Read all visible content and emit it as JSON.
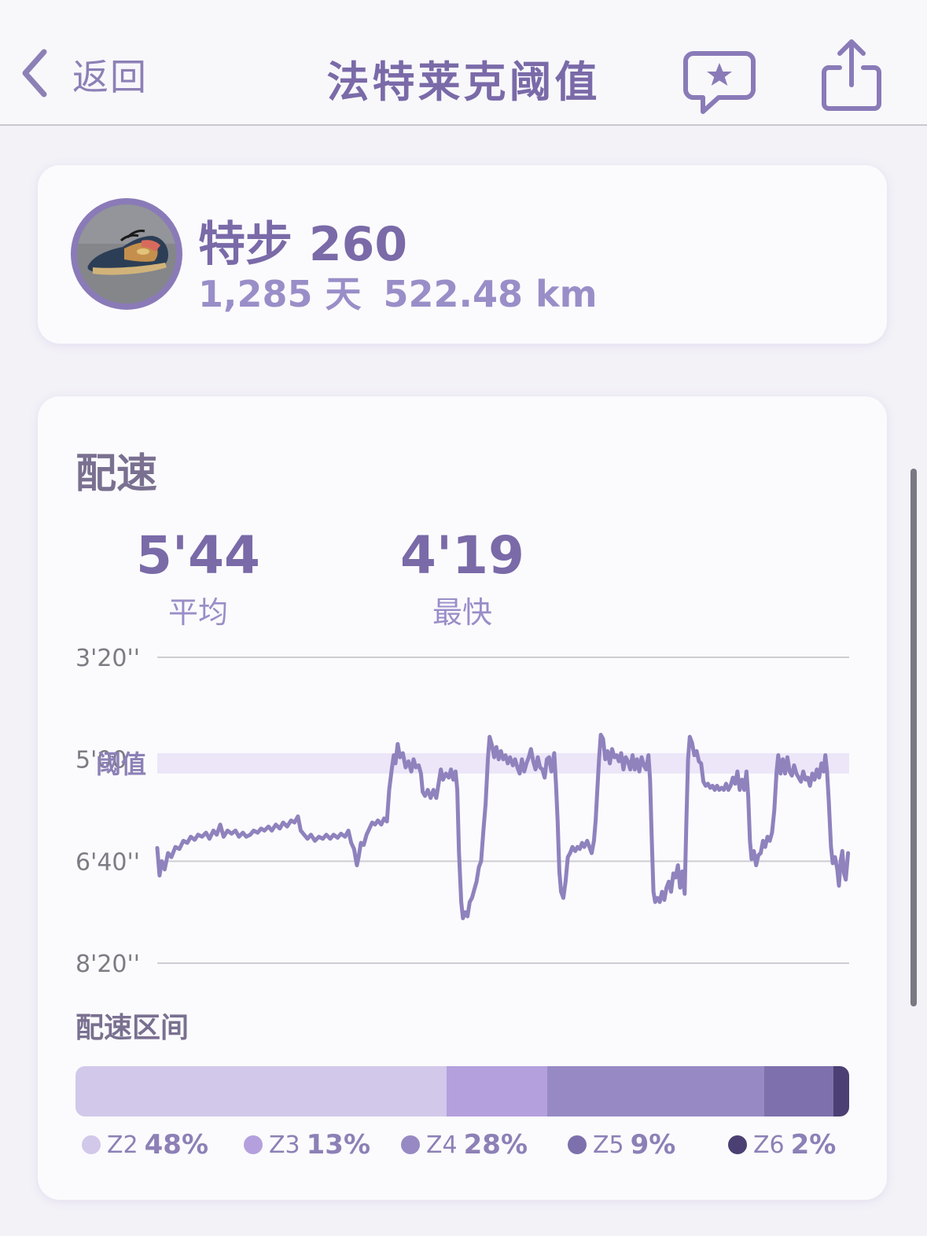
{
  "nav": {
    "back_label": "返回",
    "title": "法特莱克阈值"
  },
  "shoe": {
    "name": "特步 260",
    "days": "1,285 天",
    "distance": "522.48 km"
  },
  "pace": {
    "section_title": "配速",
    "average_value": "5'44",
    "average_label": "平均",
    "fastest_value": "4'19",
    "fastest_label": "最快"
  },
  "chart_data": {
    "type": "line",
    "y_ticks": [
      "3'20''",
      "5'00",
      "6'40''",
      "8'20''"
    ],
    "y_tick_seconds": [
      200,
      300,
      400,
      500
    ],
    "ylim": [
      200,
      500
    ],
    "y_reversed": true,
    "threshold_label": "阈值",
    "threshold_range_seconds": [
      294,
      314
    ],
    "x_range": [
      0,
      100
    ],
    "series": [
      {
        "points": [
          [
            0,
            387
          ],
          [
            0.4,
            414
          ],
          [
            0.8,
            400
          ],
          [
            1.3,
            408
          ],
          [
            1.9,
            392
          ],
          [
            2.5,
            396
          ],
          [
            3.2,
            386
          ],
          [
            3.9,
            388
          ],
          [
            4.6,
            380
          ],
          [
            5.3,
            382
          ],
          [
            5.9,
            376
          ],
          [
            6.6,
            379
          ],
          [
            7.2,
            374
          ],
          [
            7.9,
            376
          ],
          [
            8.6,
            372
          ],
          [
            9.2,
            378
          ],
          [
            9.9,
            370
          ],
          [
            10.5,
            374
          ],
          [
            11.1,
            364
          ],
          [
            11.7,
            376
          ],
          [
            12.4,
            370
          ],
          [
            13.1,
            373
          ],
          [
            13.8,
            370
          ],
          [
            14.4,
            376
          ],
          [
            15.1,
            372
          ],
          [
            15.7,
            376
          ],
          [
            16.4,
            374
          ],
          [
            17.0,
            370
          ],
          [
            17.7,
            372
          ],
          [
            18.3,
            368
          ],
          [
            18.9,
            370
          ],
          [
            19.6,
            366
          ],
          [
            20.2,
            370
          ],
          [
            20.9,
            364
          ],
          [
            21.6,
            368
          ],
          [
            22.2,
            362
          ],
          [
            22.9,
            366
          ],
          [
            23.6,
            360
          ],
          [
            24.2,
            362
          ],
          [
            24.8,
            356
          ],
          [
            25.3,
            370
          ],
          [
            25.9,
            374
          ],
          [
            26.5,
            378
          ],
          [
            27.1,
            374
          ],
          [
            27.8,
            380
          ],
          [
            28.5,
            376
          ],
          [
            29.2,
            378
          ],
          [
            29.8,
            374
          ],
          [
            30.5,
            378
          ],
          [
            31.1,
            374
          ],
          [
            31.8,
            377
          ],
          [
            32.4,
            373
          ],
          [
            33.1,
            376
          ],
          [
            33.7,
            370
          ],
          [
            34.2,
            382
          ],
          [
            34.7,
            388
          ],
          [
            35.2,
            404
          ],
          [
            35.5,
            396
          ],
          [
            35.9,
            382
          ],
          [
            36.4,
            384
          ],
          [
            36.9,
            374
          ],
          [
            37.4,
            368
          ],
          [
            37.9,
            362
          ],
          [
            38.4,
            364
          ],
          [
            38.9,
            360
          ],
          [
            39.5,
            364
          ],
          [
            40.0,
            358
          ],
          [
            40.5,
            361
          ],
          [
            40.9,
            330
          ],
          [
            41.3,
            312
          ],
          [
            41.7,
            296
          ],
          [
            42.0,
            304
          ],
          [
            42.4,
            285
          ],
          [
            42.8,
            298
          ],
          [
            43.3,
            294
          ],
          [
            43.8,
            308
          ],
          [
            44.3,
            302
          ],
          [
            44.8,
            312
          ],
          [
            45.2,
            300
          ],
          [
            45.6,
            308
          ],
          [
            46.1,
            306
          ],
          [
            46.5,
            314
          ],
          [
            46.8,
            332
          ],
          [
            47.2,
            336
          ],
          [
            47.7,
            330
          ],
          [
            48.2,
            338
          ],
          [
            48.7,
            330
          ],
          [
            49.2,
            338
          ],
          [
            49.6,
            324
          ],
          [
            50.0,
            310
          ],
          [
            50.4,
            320
          ],
          [
            50.9,
            314
          ],
          [
            51.4,
            318
          ],
          [
            51.8,
            310
          ],
          [
            52.2,
            320
          ],
          [
            52.6,
            312
          ],
          [
            52.9,
            330
          ],
          [
            53.2,
            390
          ],
          [
            53.6,
            440
          ],
          [
            53.9,
            456
          ],
          [
            54.3,
            450
          ],
          [
            54.7,
            454
          ],
          [
            55.1,
            440
          ],
          [
            55.5,
            436
          ],
          [
            55.9,
            428
          ],
          [
            56.3,
            420
          ],
          [
            56.7,
            406
          ],
          [
            57.1,
            400
          ],
          [
            57.5,
            370
          ],
          [
            57.9,
            344
          ],
          [
            58.3,
            300
          ],
          [
            58.6,
            278
          ],
          [
            59.0,
            286
          ],
          [
            59.4,
            298
          ],
          [
            59.8,
            288
          ],
          [
            60.2,
            300
          ],
          [
            60.6,
            292
          ],
          [
            61.0,
            300
          ],
          [
            61.4,
            296
          ],
          [
            61.8,
            304
          ],
          [
            62.2,
            298
          ],
          [
            62.7,
            306
          ],
          [
            63.1,
            300
          ],
          [
            63.5,
            308
          ],
          [
            63.9,
            314
          ],
          [
            64.3,
            300
          ],
          [
            64.7,
            312
          ],
          [
            65.1,
            304
          ],
          [
            65.5,
            298
          ],
          [
            65.9,
            290
          ],
          [
            66.3,
            302
          ],
          [
            66.7,
            310
          ],
          [
            67.1,
            298
          ],
          [
            67.5,
            308
          ],
          [
            67.9,
            310
          ],
          [
            68.3,
            318
          ],
          [
            68.7,
            300
          ],
          [
            69.1,
            298
          ],
          [
            69.5,
            312
          ],
          [
            70.0,
            294
          ],
          [
            70.3,
            324
          ],
          [
            70.6,
            360
          ],
          [
            70.9,
            410
          ],
          [
            71.2,
            430
          ],
          [
            71.6,
            436
          ],
          [
            72.0,
            420
          ],
          [
            72.4,
            396
          ],
          [
            72.8,
            392
          ],
          [
            73.2,
            386
          ],
          [
            73.7,
            390
          ],
          [
            74.1,
            386
          ],
          [
            74.5,
            388
          ],
          [
            74.9,
            382
          ],
          [
            75.3,
            386
          ],
          [
            75.8,
            380
          ],
          [
            76.2,
            386
          ],
          [
            76.6,
            392
          ],
          [
            77.0,
            380
          ],
          [
            77.3,
            360
          ],
          [
            77.6,
            330
          ],
          [
            77.9,
            300
          ],
          [
            78.2,
            276
          ],
          [
            78.6,
            280
          ],
          [
            79.0,
            300
          ],
          [
            79.4,
            292
          ],
          [
            79.8,
            304
          ],
          [
            80.2,
            290
          ],
          [
            80.6,
            298
          ],
          [
            81.0,
            296
          ],
          [
            81.4,
            302
          ],
          [
            81.8,
            294
          ],
          [
            82.2,
            310
          ],
          [
            82.6,
            298
          ],
          [
            83.0,
            302
          ],
          [
            83.4,
            310
          ],
          [
            83.8,
            296
          ],
          [
            84.2,
            310
          ],
          [
            84.6,
            300
          ],
          [
            85.0,
            312
          ],
          [
            85.4,
            298
          ],
          [
            85.8,
            306
          ],
          [
            86.2,
            310
          ],
          [
            86.6,
            296
          ],
          [
            86.9,
            320
          ],
          [
            87.2,
            380
          ],
          [
            87.5,
            430
          ],
          [
            87.8,
            440
          ],
          [
            88.2,
            436
          ],
          [
            88.6,
            440
          ],
          [
            89.0,
            430
          ],
          [
            89.4,
            438
          ],
          [
            89.8,
            426
          ],
          [
            90.2,
            420
          ],
          [
            90.6,
            430
          ],
          [
            91.0,
            412
          ],
          [
            91.4,
            416
          ],
          [
            91.8,
            404
          ],
          [
            92.2,
            426
          ],
          [
            92.6,
            410
          ],
          [
            93.0,
            432
          ],
          [
            93.3,
            360
          ],
          [
            93.6,
            300
          ],
          [
            93.9,
            278
          ],
          [
            94.3,
            284
          ],
          [
            94.7,
            296
          ],
          [
            95.1,
            292
          ],
          [
            95.5,
            302
          ],
          [
            95.9,
            304
          ],
          [
            96.3,
            322
          ],
          [
            96.7,
            326
          ],
          [
            97.1,
            324
          ],
          [
            97.5,
            328
          ],
          [
            97.9,
            326
          ],
          [
            98.3,
            330
          ],
          [
            98.7,
            326
          ],
          [
            99.1,
            330
          ],
          [
            99.5,
            328
          ],
          [
            99.9,
            330
          ],
          [
            100.3,
            324
          ],
          [
            100.7,
            330
          ],
          [
            101.1,
            326
          ],
          [
            101.5,
            318
          ],
          [
            101.9,
            324
          ],
          [
            102.3,
            312
          ],
          [
            102.7,
            330
          ],
          [
            103.1,
            320
          ],
          [
            103.5,
            330
          ],
          [
            103.9,
            312
          ],
          [
            104.2,
            336
          ],
          [
            104.5,
            380
          ],
          [
            104.8,
            398
          ],
          [
            105.2,
            390
          ],
          [
            105.6,
            404
          ],
          [
            106.0,
            394
          ],
          [
            106.4,
            392
          ],
          [
            106.8,
            380
          ],
          [
            107.2,
            386
          ],
          [
            107.6,
            376
          ],
          [
            108.0,
            380
          ],
          [
            108.4,
            372
          ],
          [
            108.8,
            350
          ],
          [
            109.2,
            312
          ],
          [
            109.5,
            296
          ],
          [
            109.9,
            314
          ],
          [
            110.3,
            300
          ],
          [
            110.7,
            314
          ],
          [
            111.1,
            298
          ],
          [
            111.5,
            312
          ],
          [
            111.9,
            316
          ],
          [
            112.3,
            306
          ],
          [
            112.7,
            314
          ],
          [
            113.1,
            318
          ],
          [
            113.5,
            322
          ],
          [
            113.9,
            312
          ],
          [
            114.3,
            320
          ],
          [
            114.7,
            318
          ],
          [
            115.1,
            326
          ],
          [
            115.5,
            314
          ],
          [
            115.9,
            320
          ],
          [
            116.3,
            310
          ],
          [
            116.7,
            318
          ],
          [
            117.1,
            304
          ],
          [
            117.5,
            312
          ],
          [
            117.8,
            296
          ],
          [
            118.1,
            312
          ],
          [
            118.4,
            340
          ],
          [
            118.8,
            386
          ],
          [
            119.1,
            402
          ],
          [
            119.5,
            396
          ],
          [
            119.9,
            408
          ],
          [
            120.2,
            424
          ],
          [
            120.5,
            400
          ],
          [
            120.8,
            390
          ],
          [
            121.1,
            412
          ],
          [
            121.4,
            418
          ],
          [
            121.8,
            392
          ]
        ]
      }
    ]
  },
  "zones": {
    "title": "配速区间",
    "items": [
      {
        "name": "Z2",
        "percent": "48%",
        "value": 48,
        "color": "#d2c8ea"
      },
      {
        "name": "Z3",
        "percent": "13%",
        "value": 13,
        "color": "#b4a0dd"
      },
      {
        "name": "Z4",
        "percent": "28%",
        "value": 28,
        "color": "#978ac4"
      },
      {
        "name": "Z5",
        "percent": "9%",
        "value": 9,
        "color": "#7e70ac"
      },
      {
        "name": "Z6",
        "percent": "2%",
        "value": 2,
        "color": "#4c3f73"
      }
    ]
  },
  "colors": {
    "accent": "#7a6aa8",
    "line": "#8f82bd",
    "threshold_band": "#ece6f8",
    "grid": "#cfcdd3",
    "background": "#f3f2f7"
  },
  "icons": {
    "back": "chevron-left-icon",
    "review": "chat-star-icon",
    "share": "share-icon",
    "shoe_photo": "shoe-photo"
  }
}
